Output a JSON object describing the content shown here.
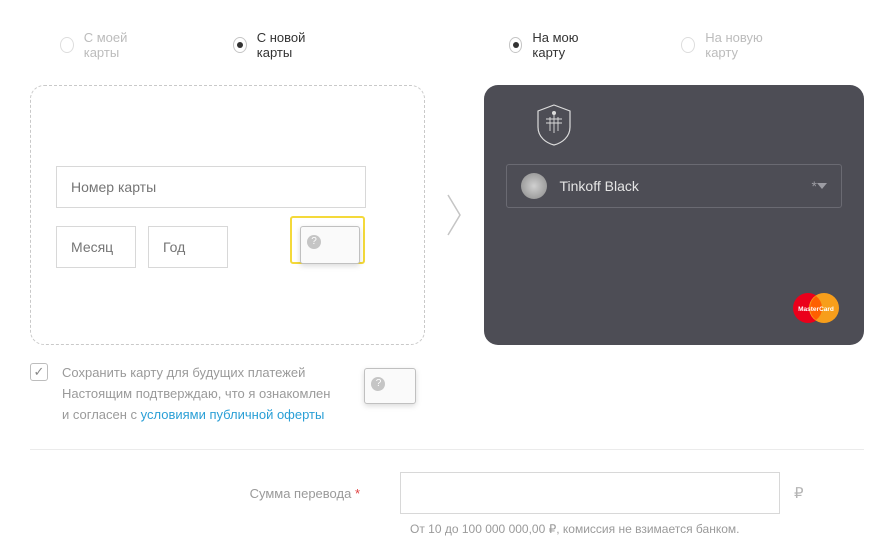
{
  "radios": {
    "from_my": "С моей карты",
    "from_new": "С новой карты",
    "to_my": "На мою карту",
    "to_new": "На новую карту"
  },
  "source": {
    "card_number_ph": "Номер карты",
    "month_ph": "Месяц",
    "year_ph": "Год"
  },
  "dest": {
    "select_label": "Tinkoff Black",
    "mc_text": "MasterCard"
  },
  "save": {
    "line1": "Сохранить карту для будущих платежей",
    "line2": "Настоящим подтверждаю, что я ознакомлен",
    "line3_prefix": "и согласен с ",
    "link": "условиями публичной оферты"
  },
  "amount": {
    "label": "Сумма перевода",
    "currency": "₽",
    "hint": "От 10 до 100 000 000,00 ₽, комиссия не взимается банком."
  }
}
